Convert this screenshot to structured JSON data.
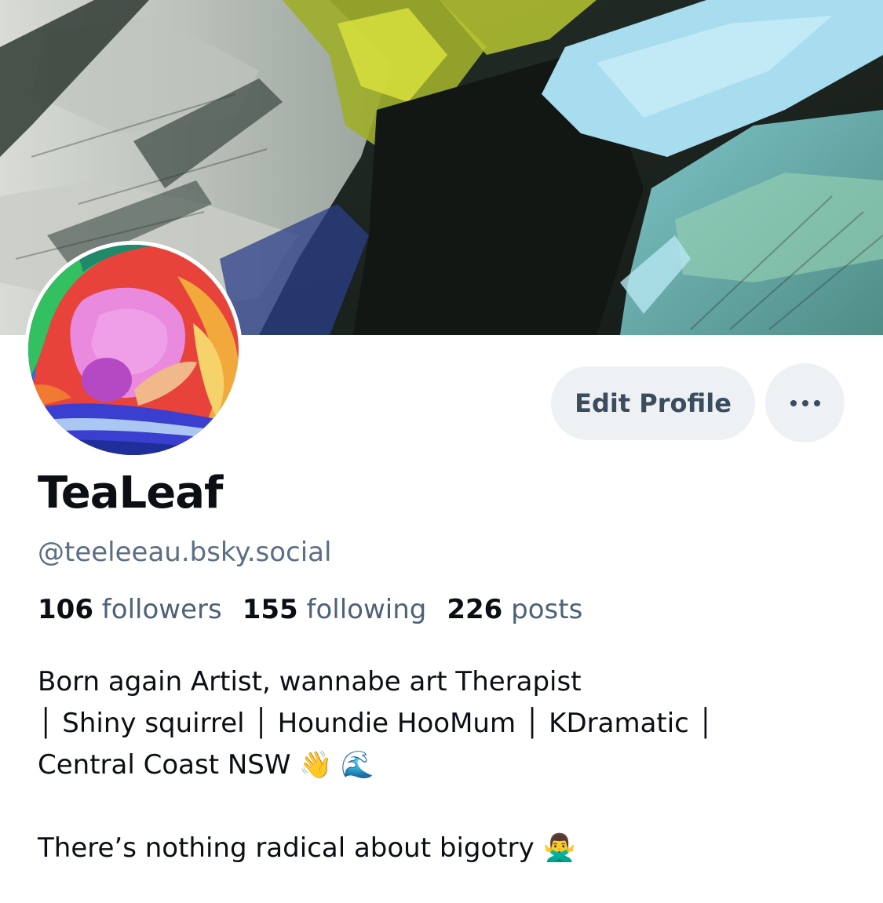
{
  "profile": {
    "display_name": "TeaLeaf",
    "handle": "@teeleeau.bsky.social"
  },
  "actions": {
    "edit_profile_label": "Edit Profile",
    "more_icon": "ellipsis-icon"
  },
  "stats": {
    "followers_count": "106",
    "followers_label": "followers",
    "following_count": "155",
    "following_label": "following",
    "posts_count": "226",
    "posts_label": "posts"
  },
  "bio": {
    "line1": "Born again Artist, wannabe art Therapist",
    "line2": "│ Shiny squirrel │ Houndie HooMum │ KDramatic │",
    "line3": "Central Coast NSW 👋 🌊",
    "line4": "There’s nothing radical about bigotry 🙅‍♂️"
  },
  "colors": {
    "accent_button_bg": "#eef1f4",
    "button_text": "#3b4c5f",
    "secondary_text": "#5b6e82"
  }
}
